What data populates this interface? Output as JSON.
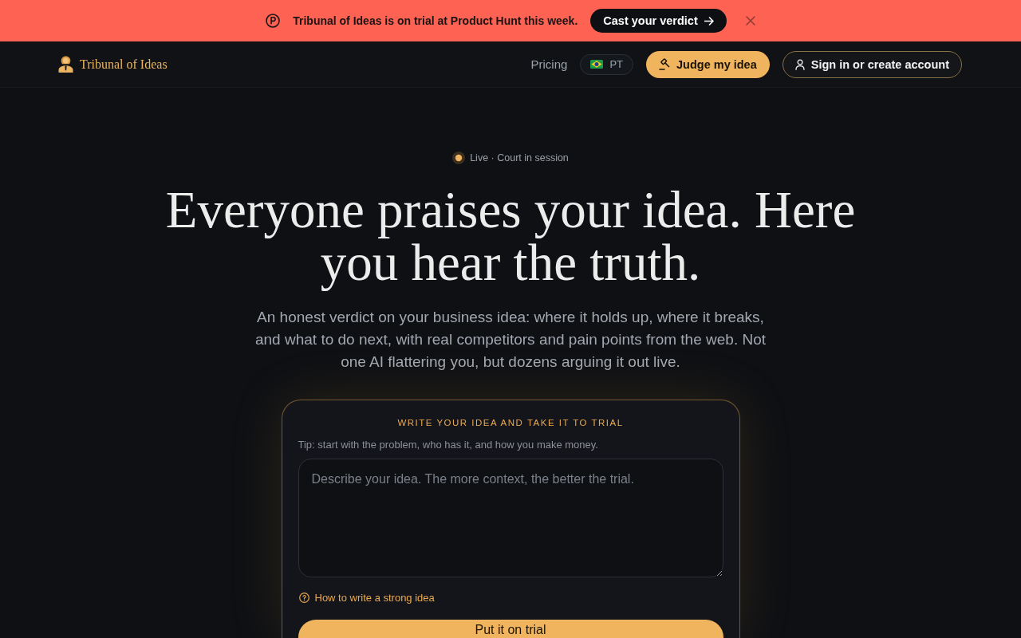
{
  "announcement_bar": {
    "text": "Tribunal of Ideas is on trial at Product Hunt this week.",
    "button": "Cast your verdict"
  },
  "nav": {
    "brand": "Tribunal of Ideas",
    "pricing": "Pricing",
    "language": "PT",
    "primary_button": "Judge my idea",
    "account_button": "Sign in or create account"
  },
  "hero": {
    "status": "Live · Court in session",
    "live": true,
    "headline": "Everyone praises your idea. Here you hear the truth.",
    "subtitle": "An honest verdict on your business idea: where it holds up, where it breaks, and what to do next, with real competitors and pain points from the web. Not one AI flattering you, but dozens arguing it out live."
  },
  "idea_form": {
    "title": "WRITE YOUR IDEA AND TAKE IT TO TRIAL",
    "tip": "Tip: start with the problem, who has it, and how you make money.",
    "placeholder": "Describe your idea. The more context, the better the trial.",
    "help_link": "How to write a strong idea",
    "submit": "Put it on trial"
  }
}
